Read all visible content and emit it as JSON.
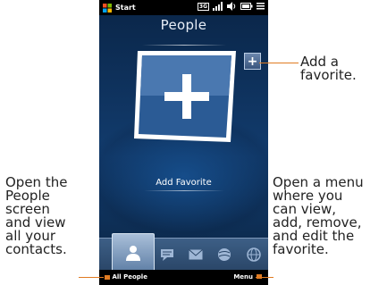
{
  "status_bar": {
    "start_label": "Start",
    "icons": [
      "3g-data-icon",
      "signal-icon",
      "volume-icon",
      "battery-icon",
      "menu-icon"
    ],
    "network_text": "3G"
  },
  "screen": {
    "title": "People",
    "add_favorite_label": "Add Favorite",
    "plus_button_label": "+"
  },
  "tabs": [
    {
      "name": "people",
      "active": true
    },
    {
      "name": "messages"
    },
    {
      "name": "email"
    },
    {
      "name": "phone"
    },
    {
      "name": "internet"
    }
  ],
  "softkeys": {
    "left": "All People",
    "right": "Menu"
  },
  "callouts": {
    "add_favorite": "Add a\nfavorite.",
    "open_people": "Open the\nPeople\nscreen\nand view\nall your\ncontacts.",
    "open_menu": "Open a menu\nwhere you\ncan view,\nadd, remove,\nand edit the\nfavorite."
  },
  "colors": {
    "accent": "#e07b22",
    "screen_bg": "#0b2a4d"
  }
}
